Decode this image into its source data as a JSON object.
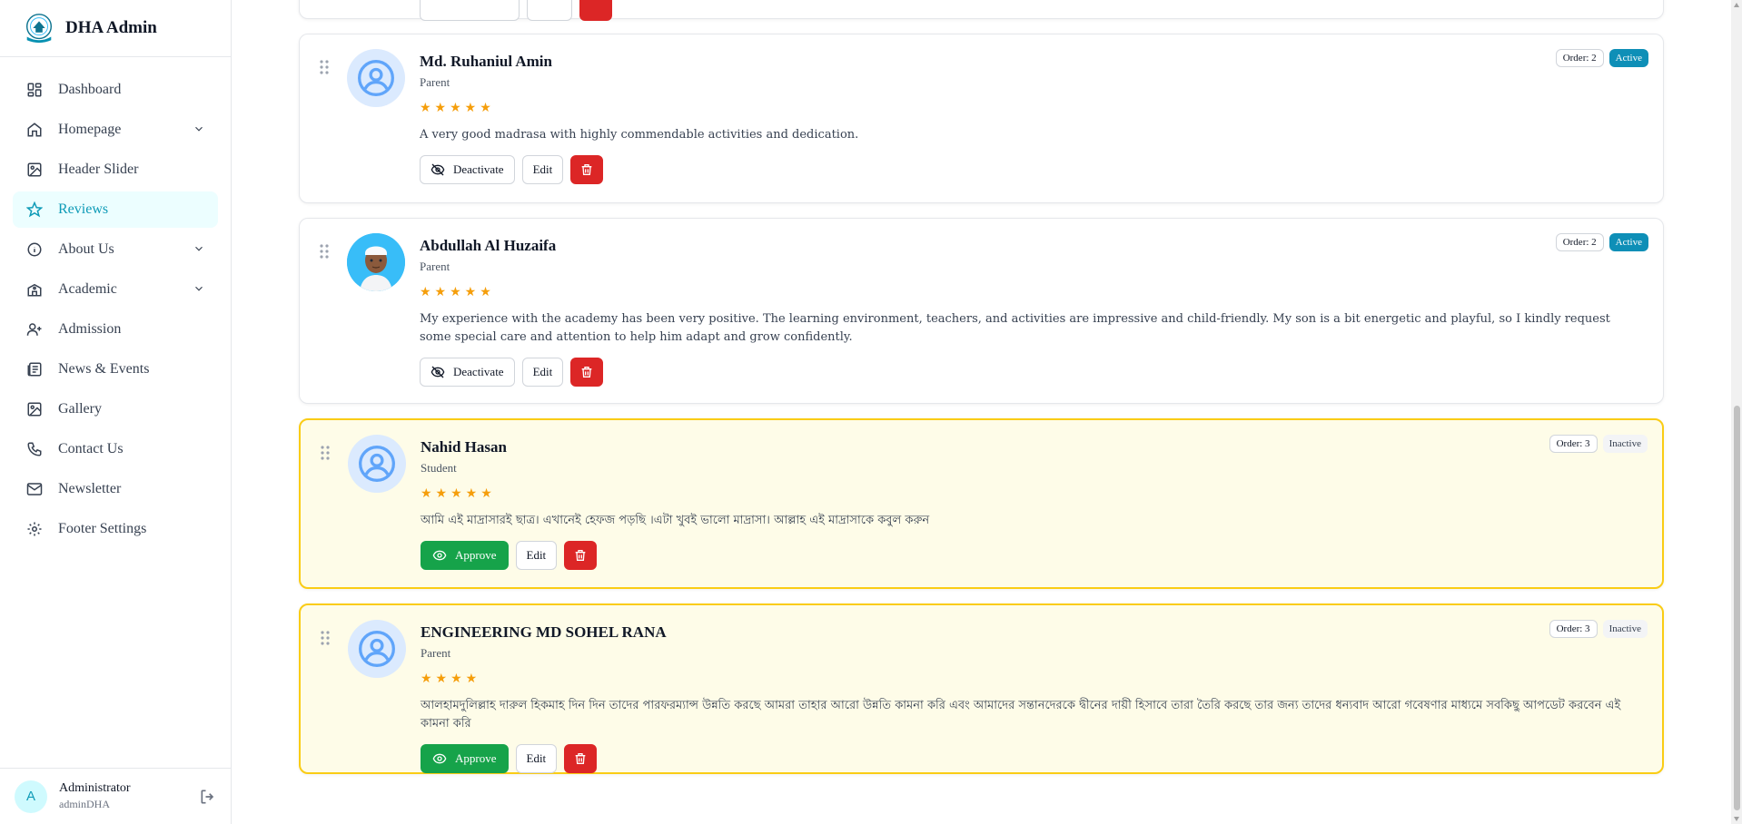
{
  "sidebar": {
    "brand": "DHA Admin",
    "items": [
      {
        "label": "Dashboard",
        "icon": "dashboard-icon"
      },
      {
        "label": "Homepage",
        "icon": "home-icon",
        "expandable": true
      },
      {
        "label": "Header Slider",
        "icon": "image-icon"
      },
      {
        "label": "Reviews",
        "icon": "star-icon",
        "active": true
      },
      {
        "label": "About Us",
        "icon": "info-icon",
        "expandable": true
      },
      {
        "label": "Academic",
        "icon": "school-icon",
        "expandable": true
      },
      {
        "label": "Admission",
        "icon": "user-plus-icon"
      },
      {
        "label": "News & Events",
        "icon": "newspaper-icon"
      },
      {
        "label": "Gallery",
        "icon": "gallery-icon"
      },
      {
        "label": "Contact Us",
        "icon": "phone-icon"
      },
      {
        "label": "Newsletter",
        "icon": "mail-icon"
      },
      {
        "label": "Footer Settings",
        "icon": "gear-icon"
      }
    ],
    "user": {
      "initial": "A",
      "name": "Administrator",
      "username": "adminDHA"
    }
  },
  "reviews": [
    {
      "name": "Md. Ruhaniul Amin",
      "role": "Parent",
      "stars": "★★★★★",
      "text": "A very good madrasa with highly commendable activities and dedication.",
      "order": "Order: 2",
      "status": "Active",
      "toggle_label": "Deactivate",
      "edit_label": "Edit",
      "photo": false,
      "pending": false
    },
    {
      "name": "Abdullah Al Huzaifa",
      "role": "Parent",
      "stars": "★★★★★",
      "text": "My experience with the academy has been very positive. The learning environment, teachers, and activities are impressive and child-friendly. My son is a bit energetic and playful, so I kindly request some special care and attention to help him adapt and grow confidently.",
      "order": "Order: 2",
      "status": "Active",
      "toggle_label": "Deactivate",
      "edit_label": "Edit",
      "photo": true,
      "pending": false
    },
    {
      "name": "Nahid Hasan",
      "role": "Student",
      "stars": "★★★★★",
      "text": "আমি এই মাদ্রাসারই ছাত্র। এখানেই হেফজ পড়ছি ।এটা খুবই ভালো মাদ্রাসা। আল্লাহ এই মাদ্রাসাকে কবুল করুন",
      "order": "Order: 3",
      "status": "Inactive",
      "toggle_label": "Approve",
      "edit_label": "Edit",
      "photo": false,
      "pending": true
    },
    {
      "name": "ENGINEERING MD SOHEL RANA",
      "role": "Parent",
      "stars": "★★★★",
      "text": "আলহামদুলিল্লাহ দারুল হিকমাহ দিন দিন তাদের পারফরম্যান্স উন্নতি করছে আমরা তাহার আরো উন্নতি কামনা করি এবং আমাদের সন্তানদেরকে দ্বীনের দায়ী হিসাবে তারা তৈরি করছে তার জন্য তাদের ধন্যবাদ আরো গবেষণার মাধ্যমে সবকিছু আপডেট করবেন এই কামনা করি",
      "order": "Order: 3",
      "status": "Inactive",
      "toggle_label": "Approve",
      "edit_label": "Edit",
      "photo": false,
      "pending": true
    }
  ],
  "colors": {
    "accent": "#0e9bb7",
    "active_badge": "#0e8fb7",
    "approve": "#16a34a",
    "delete": "#dc2626",
    "star": "#f59e0b",
    "pending_border": "#facc15"
  }
}
